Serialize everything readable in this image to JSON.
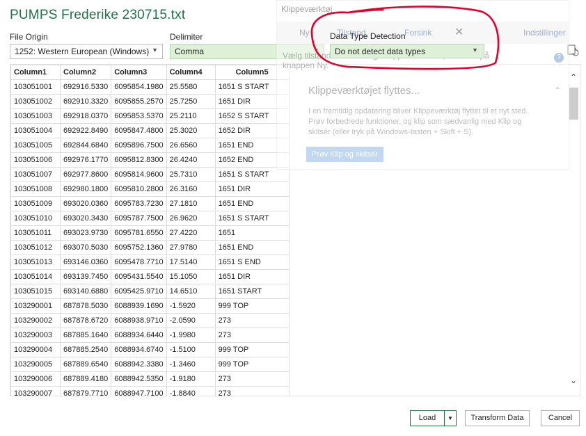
{
  "window": {
    "title": "PUMPS Frederike 230715.txt"
  },
  "file_origin": {
    "label": "File Origin",
    "value": "1252: Western European (Windows)"
  },
  "delimiter": {
    "label": "Delimiter",
    "value": "Comma"
  },
  "data_type_detection": {
    "label": "Data Type Detection",
    "value": "Do not detect data types"
  },
  "table": {
    "columns": [
      "Column1",
      "Column2",
      "Column3",
      "Column4",
      "Column5"
    ],
    "rows": [
      [
        "103051001",
        "692916.5330",
        "6095854.1980",
        "25.5580",
        "1651 S START"
      ],
      [
        "103051002",
        "692910.3320",
        "6095855.2570",
        "25.7250",
        "1651 DIR"
      ],
      [
        "103051003",
        "692918.0370",
        "6095853.5370",
        "25.2110",
        "1652 S START"
      ],
      [
        "103051004",
        "692922.8490",
        "6095847.4800",
        "25.3020",
        "1652 DIR"
      ],
      [
        "103051005",
        "692844.6840",
        "6095896.7500",
        "26.6560",
        "1651 END"
      ],
      [
        "103051006",
        "692976.1770",
        "6095812.8300",
        "26.4240",
        "1652 END"
      ],
      [
        "103051007",
        "692977.8600",
        "6095814.9600",
        "25.7310",
        "1651 S START"
      ],
      [
        "103051008",
        "692980.1800",
        "6095810.2800",
        "26.3160",
        "1651 DIR"
      ],
      [
        "103051009",
        "693020.0360",
        "6095783.7230",
        "27.1810",
        "1651 END"
      ],
      [
        "103051010",
        "693020.3430",
        "6095787.7500",
        "26.9620",
        "1651 S START"
      ],
      [
        "103051011",
        "693023.9730",
        "6095781.6550",
        "27.4220",
        "1651"
      ],
      [
        "103051012",
        "693070.5030",
        "6095752.1360",
        "27.9780",
        "1651 END"
      ],
      [
        "103051013",
        "693146.0360",
        "6095478.7710",
        "17.5140",
        "1651 S END"
      ],
      [
        "103051014",
        "693139.7450",
        "6095431.5540",
        "15.1050",
        "1651 DIR"
      ],
      [
        "103051015",
        "693140.6880",
        "6095425.9710",
        "14.6510",
        "1651 START"
      ],
      [
        "103290001",
        "687878.5030",
        "6088939.1690",
        "-1.5920",
        "999 TOP"
      ],
      [
        "103290002",
        "687878.6720",
        "6088938.9710",
        "-2.0590",
        "273"
      ],
      [
        "103290003",
        "687885.1640",
        "6088934.6440",
        "-1.9980",
        "273"
      ],
      [
        "103290004",
        "687885.2540",
        "6088934.6740",
        "-1.5100",
        "999 TOP"
      ],
      [
        "103290005",
        "687889.6540",
        "6088942.3380",
        "-1.3460",
        "999 TOP"
      ],
      [
        "103290006",
        "687889.4180",
        "6088942.5350",
        "-1.9180",
        "273"
      ],
      [
        "103290007",
        "687879.7710",
        "6088947.7100",
        "-1.8840",
        "273"
      ]
    ]
  },
  "snipping_tool": {
    "title": "Klippeværktøj",
    "new_label": "Ny",
    "mode_label": "Tilstand",
    "delay_label": "Forsink",
    "settings_label": "Indstillinger",
    "instruction": "Vælg tilstanden eller brug knappen Tilstand, eller klik på knappen Ny.",
    "notice_title": "Klippeværktøjet flyttes...",
    "notice_body": "I en fremtidig opdatering bliver Klippeværktøj flyttet til et nyt sted. Prøv forbedrede funktioner, og klip som sædvanlig med Klip og skitsér (eller tryk på Windows-tasten + Skift + S).",
    "try_button": "Prøv Klip og skitsér",
    "help_icon": "?"
  },
  "buttons": {
    "load": "Load",
    "transform": "Transform Data",
    "cancel": "Cancel"
  },
  "colors": {
    "title_green": "#217346",
    "selection_green": "#dff0d8",
    "annotation_red": "#e4002b"
  }
}
